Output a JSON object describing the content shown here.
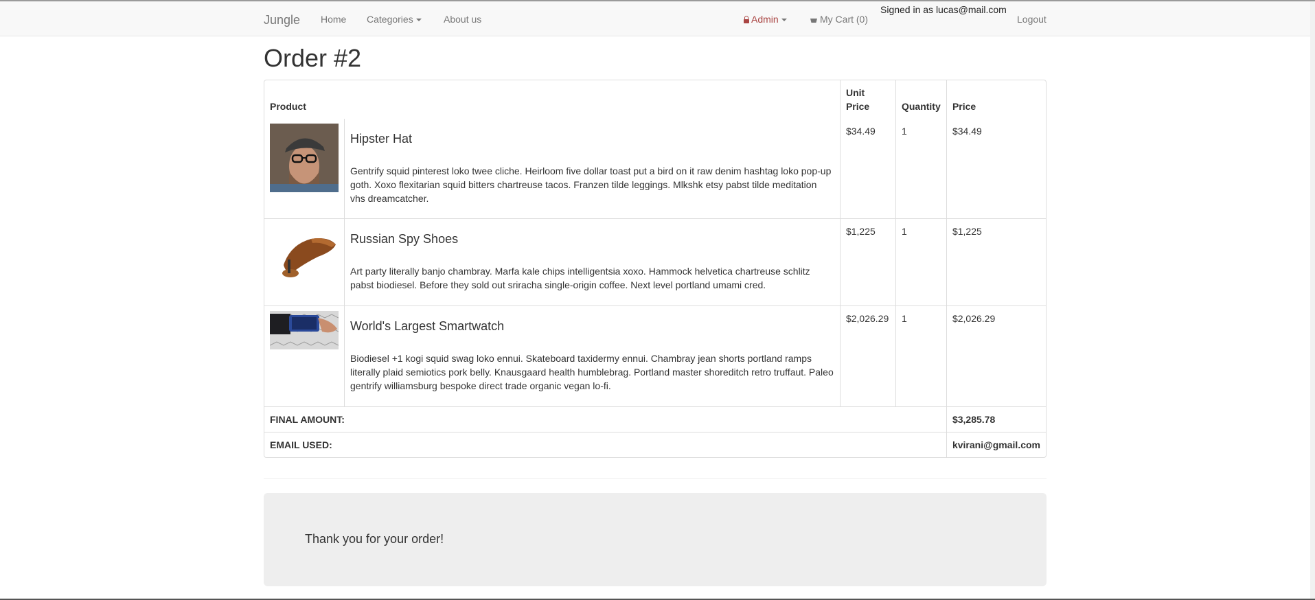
{
  "navbar": {
    "brand": "Jungle",
    "links": {
      "home": "Home",
      "categories": "Categories",
      "about": "About us",
      "admin": "Admin",
      "cart": "My Cart (0)",
      "logout": "Logout"
    },
    "signed_in": "Signed in as lucas@mail.com",
    "icons": {
      "admin": "lock-icon",
      "cart": "shopping-cart-icon"
    }
  },
  "page": {
    "title": "Order #2"
  },
  "table": {
    "headers": {
      "product": "Product",
      "unit_price": "Unit Price",
      "quantity": "Quantity",
      "price": "Price"
    },
    "items": [
      {
        "name": "Hipster Hat",
        "description": "Gentrify squid pinterest loko twee cliche. Heirloom five dollar toast put a bird on it raw denim hashtag loko pop-up goth. Xoxo flexitarian squid bitters chartreuse tacos. Franzen tilde leggings. Mlkshk etsy pabst tilde meditation vhs dreamcatcher.",
        "unit_price": "$34.49",
        "quantity": "1",
        "price": "$34.49"
      },
      {
        "name": "Russian Spy Shoes",
        "description": "Art party literally banjo chambray. Marfa kale chips intelligentsia xoxo. Hammock helvetica chartreuse schlitz pabst biodiesel. Before they sold out sriracha single-origin coffee. Next level portland umami cred.",
        "unit_price": "$1,225",
        "quantity": "1",
        "price": "$1,225"
      },
      {
        "name": "World's Largest Smartwatch",
        "description": "Biodiesel +1 kogi squid swag loko ennui. Skateboard taxidermy ennui. Chambray jean shorts portland ramps literally plaid semiotics pork belly. Knausgaard health humblebrag. Portland master shoreditch retro truffaut. Paleo gentrify williamsburg bespoke direct trade organic vegan lo-fi.",
        "unit_price": "$2,026.29",
        "quantity": "1",
        "price": "$2,026.29"
      }
    ],
    "final_amount_label": "FINAL AMOUNT:",
    "final_amount": "$3,285.78",
    "email_label": "EMAIL USED:",
    "email": "kvirani@gmail.com"
  },
  "footer": {
    "thanks": "Thank you for your order!"
  },
  "colors": {
    "navbar_bg": "#f8f8f8",
    "admin_red": "#a94442",
    "jumbotron_bg": "#eeeeee",
    "border": "#dddddd"
  }
}
